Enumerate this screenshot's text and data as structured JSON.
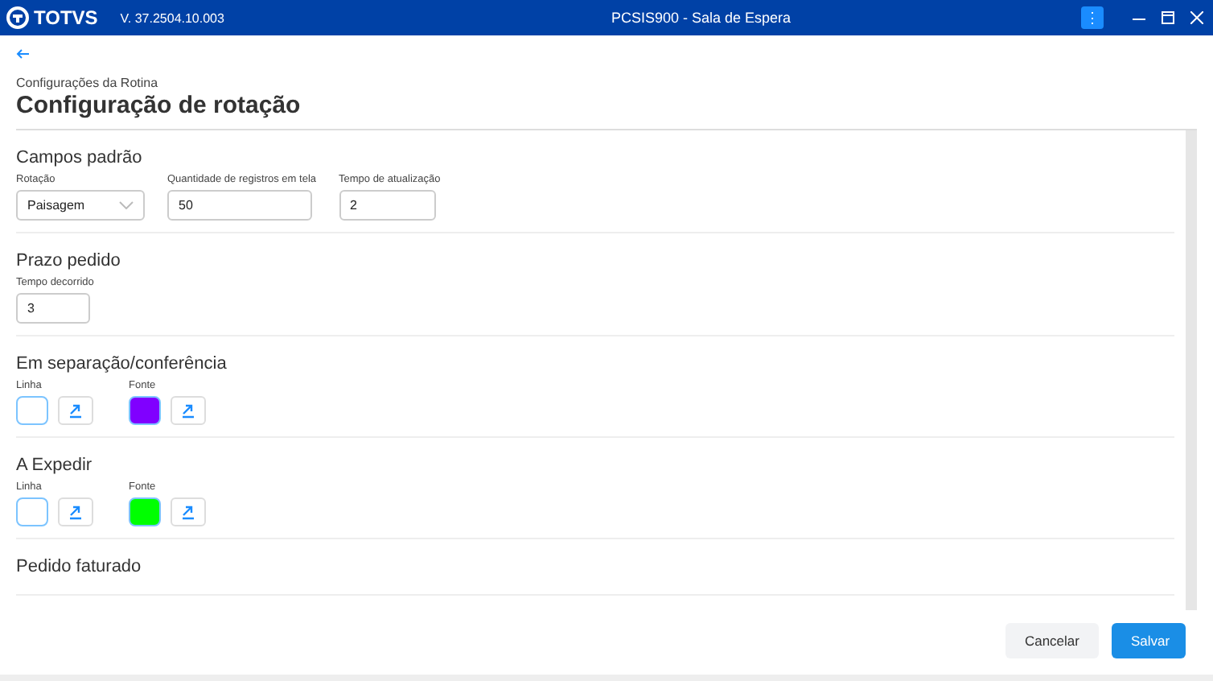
{
  "titlebar": {
    "logo": "TOTVS",
    "version": "V. 37.2504.10.003",
    "title": "PCSIS900 - Sala de Espera",
    "menu_button": "⋮"
  },
  "header": {
    "breadcrumb": "Configurações da Rotina",
    "title": "Configuração de rotação"
  },
  "sections": [
    {
      "kind": "fields",
      "title": "Campos padrão",
      "fields": [
        {
          "kind": "select",
          "label": "Rotação",
          "value": "Paisagem"
        },
        {
          "kind": "input",
          "label": "Quantidade de registros em tela",
          "value": "50"
        },
        {
          "kind": "input",
          "label": "Tempo de atualização",
          "value": "2"
        }
      ]
    },
    {
      "kind": "fields",
      "title": "Prazo pedido",
      "fields": [
        {
          "kind": "input",
          "label": "Tempo decorrido",
          "value": "3"
        }
      ]
    },
    {
      "kind": "colors",
      "title": "Em separação/conferência",
      "pickers": [
        {
          "label": "Linha",
          "color": "#ffffff"
        },
        {
          "label": "Fonte",
          "color": "#8000ff"
        }
      ]
    },
    {
      "kind": "colors",
      "title": "A Expedir",
      "pickers": [
        {
          "label": "Linha",
          "color": "#ffffff"
        },
        {
          "label": "Fonte",
          "color": "#00ff00"
        }
      ]
    },
    {
      "kind": "colors",
      "title": "Pedido faturado"
    }
  ],
  "footer": {
    "buttons": [
      {
        "kind": "secondary",
        "label": "Cancelar"
      },
      {
        "kind": "primary",
        "label": "Salvar"
      }
    ]
  }
}
